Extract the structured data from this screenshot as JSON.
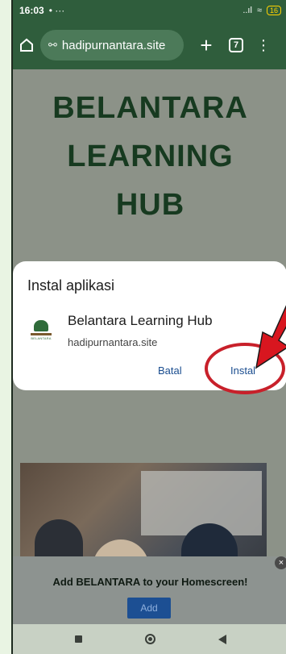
{
  "status": {
    "time": "16:03",
    "dots": "•  ···",
    "signal": "..ıl",
    "wifi": "≈",
    "battery": "16"
  },
  "browser": {
    "url": "hadipurnantara.site",
    "tab_count": "7"
  },
  "page": {
    "hero_title_1": "BELANTARA",
    "hero_title_2": "LEARNING",
    "hero_title_3": "HUB"
  },
  "dialog": {
    "title": "Instal aplikasi",
    "app_name": "Belantara Learning Hub",
    "app_url": "hadipurnantara.site",
    "cancel_label": "Batal",
    "install_label": "Instal",
    "icon_text": "BELANTARA"
  },
  "banner": {
    "text": "Add BELANTARA to your Homescreen!",
    "add_label": "Add",
    "close_label": "×"
  },
  "colors": {
    "toolbar": "#2f5d3c",
    "annotation": "#c8202a",
    "primary_text": "#1a4d8f"
  }
}
